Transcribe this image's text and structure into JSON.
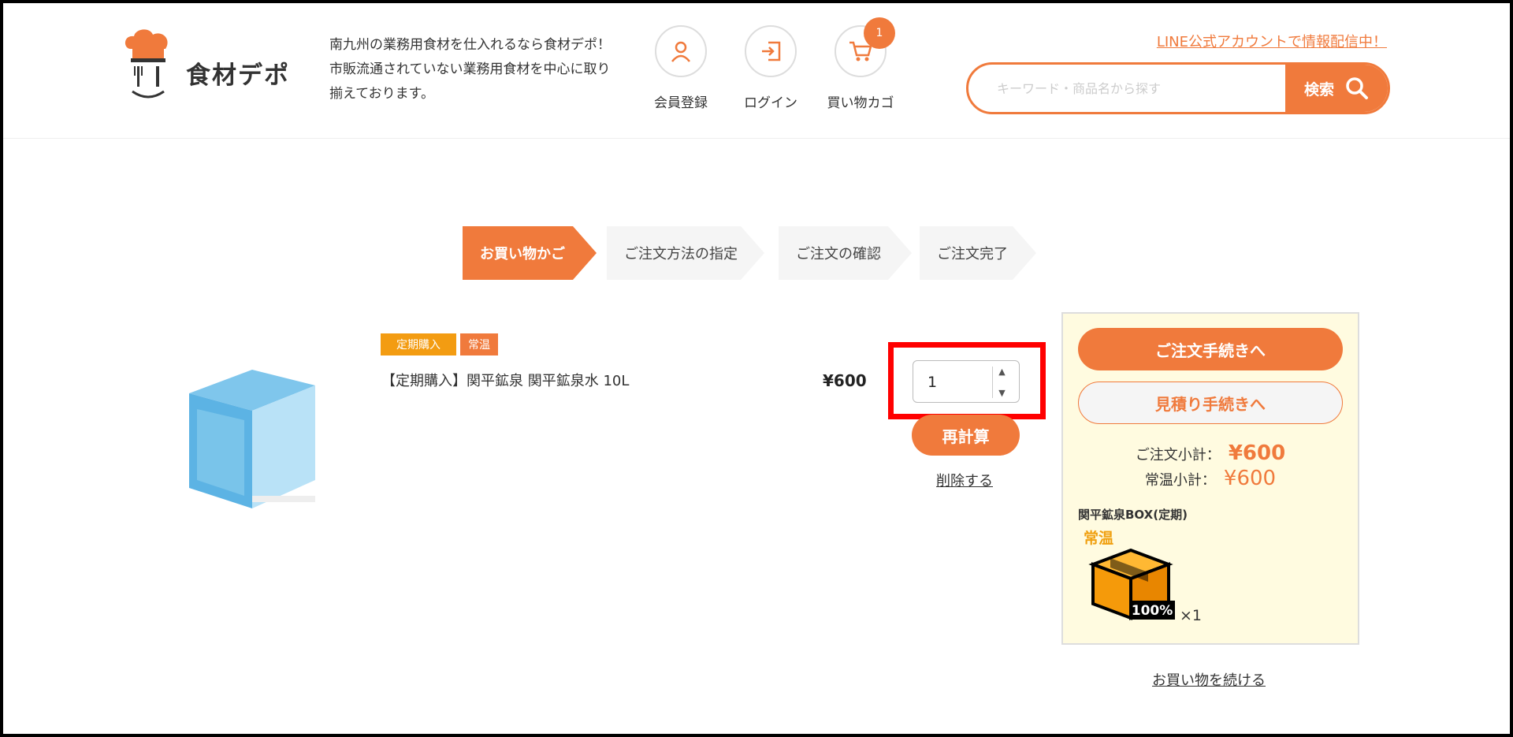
{
  "header": {
    "brand": "食材デポ",
    "tagline": "南九州の業務用食材を仕入れるなら食材デポ！市販流通されていない業務用食材を中心に取り揃えております。",
    "icons": [
      {
        "label": "会員登録",
        "icon": "user-icon"
      },
      {
        "label": "ログイン",
        "icon": "login-icon"
      },
      {
        "label": "買い物カゴ",
        "icon": "cart-icon"
      }
    ],
    "cart_count": "1",
    "line_link": "LINE公式アカウントで情報配信中！",
    "search": {
      "placeholder": "キーワード・商品名から探す",
      "button": "検索"
    }
  },
  "steps": [
    "お買い物かご",
    "ご注文方法の指定",
    "ご注文の確認",
    "ご注文完了"
  ],
  "item": {
    "tags": [
      "定期購入",
      "常温"
    ],
    "name": "【定期購入】関平鉱泉 関平鉱泉水 10L",
    "price": "¥600",
    "quantity": "1",
    "recalc": "再計算",
    "delete": "削除する"
  },
  "summary": {
    "order_button": "ご注文手続きへ",
    "quote_button": "見積り手続きへ",
    "subtotal_label": "ご注文小計：",
    "subtotal": "¥600",
    "ambient_label": "常温小計：",
    "ambient_subtotal": "¥600",
    "box_title": "関平鉱泉BOX(定期)",
    "box_temp": "常温",
    "box_percent": "100%",
    "box_qty": "×1"
  },
  "continue_link": "お買い物を続ける",
  "colors": {
    "accent": "#f07a3c",
    "highlight": "#ff0000",
    "panel_bg": "#fffbe0"
  }
}
